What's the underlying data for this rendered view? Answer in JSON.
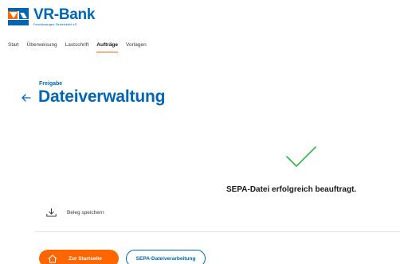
{
  "brand": {
    "name": "VR-Bank",
    "subtitle": "Feuchtwangen-Dinkelsbühl eG",
    "color_primary": "#0066b3",
    "color_accent": "#ff6600"
  },
  "nav": {
    "items": [
      {
        "label": "Start",
        "active": false
      },
      {
        "label": "Überweisung",
        "active": false
      },
      {
        "label": "Lastschrift",
        "active": false
      },
      {
        "label": "Aufträge",
        "active": true
      },
      {
        "label": "Vorlagen",
        "active": false
      }
    ]
  },
  "page": {
    "pre_title": "Freigabe",
    "title": "Dateiverwaltung",
    "back_icon": "arrow-left-icon"
  },
  "result": {
    "icon": "checkmark-icon",
    "icon_color": "#2eb84c",
    "message": "SEPA-Datei erfolgreich beauftragt."
  },
  "actions": {
    "save_label": "Beleg speichern",
    "save_icon": "download-icon",
    "primary_label": "Zur Startseite",
    "primary_icon": "home-icon",
    "secondary_label": "SEPA-Dateiverarbeitung"
  }
}
